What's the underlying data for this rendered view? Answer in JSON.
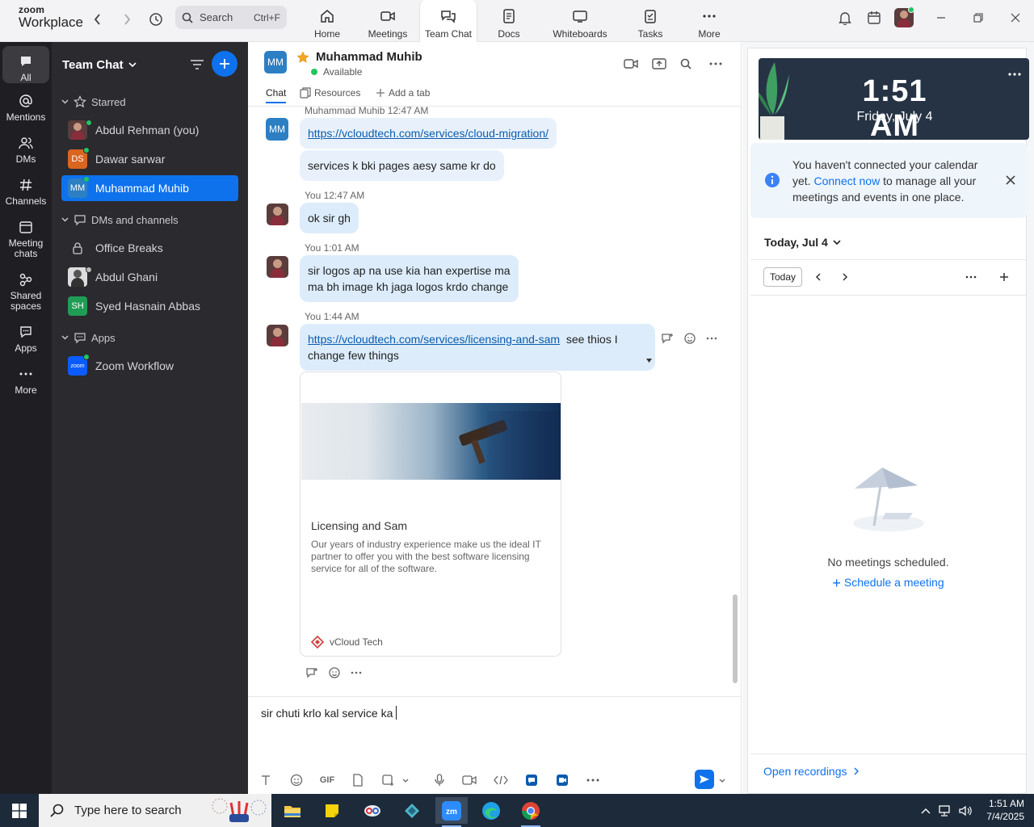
{
  "app": {
    "brand_top": "zoom",
    "brand_bottom": "Workplace"
  },
  "search": {
    "placeholder": "Search",
    "shortcut": "Ctrl+F"
  },
  "tabs": [
    {
      "label": "Home",
      "icon": "home-icon"
    },
    {
      "label": "Meetings",
      "icon": "video-camera-icon"
    },
    {
      "label": "Team Chat",
      "icon": "chat-bubbles-icon",
      "active": true
    },
    {
      "label": "Docs",
      "icon": "document-icon"
    },
    {
      "label": "Whiteboards",
      "icon": "whiteboard-icon"
    },
    {
      "label": "Tasks",
      "icon": "tasks-icon"
    },
    {
      "label": "More",
      "icon": "more-dots-icon"
    }
  ],
  "rail": [
    {
      "label": "All",
      "icon": "chat-icon",
      "active": true
    },
    {
      "label": "Mentions",
      "icon": "at-sign-icon"
    },
    {
      "label": "DMs",
      "icon": "people-icon"
    },
    {
      "label": "Channels",
      "icon": "hash-icon"
    },
    {
      "label": "Meeting chats",
      "icon": "calendar-chat-icon"
    },
    {
      "label": "Shared spaces",
      "icon": "shared-spaces-icon"
    },
    {
      "label": "Apps",
      "icon": "apps-icon"
    },
    {
      "label": "More",
      "icon": "more-dots-icon"
    }
  ],
  "chanpanel": {
    "title": "Team Chat",
    "sections": {
      "starred": "Starred",
      "dms": "DMs and channels",
      "apps": "Apps"
    },
    "starred": [
      {
        "name": "Abdul Rehman (you)",
        "initials": ""
      },
      {
        "name": "Dawar sarwar",
        "initials": "DS"
      },
      {
        "name": "Muhammad Muhib",
        "initials": "MM",
        "active": true
      }
    ],
    "dms": [
      {
        "name": "Office Breaks"
      },
      {
        "name": "Abdul Ghani"
      },
      {
        "name": "Syed Hasnain Abbas",
        "initials": "SH"
      }
    ],
    "apps": [
      {
        "name": "Zoom Workflow",
        "initials": "zoom"
      }
    ]
  },
  "chat": {
    "contact_initials": "MM",
    "contact_name": "Muhammad Muhib",
    "status": "Available",
    "tabs": {
      "chat": "Chat",
      "resources": "Resources",
      "add": "Add a tab"
    },
    "messages": {
      "m1_meta": "Muhammad Muhib 12:47 AM",
      "m1_link": "https://vcloudtech.com/services/cloud-migration/",
      "m1_text2": "services k bki pages aesy same kr do",
      "m2_meta": "You 12:47 AM",
      "m2_text": "ok sir gh",
      "m3_meta": "You 1:01 AM",
      "m3_line1": "sir logos ap na use kia han expertise ma",
      "m3_line2": "ma bh image kh jaga logos krdo change",
      "m4_meta": "You 1:44 AM",
      "m4_link": "https://vcloudtech.com/services/licensing-and-sam",
      "m4_text_a": "see thios I",
      "m4_text_b": "change few things"
    },
    "card": {
      "title": "Licensing and Sam",
      "description": "Our years of industry experience make us the ideal IT partner to offer you with the best software licensing service for all of the software.",
      "site": "vCloud Tech"
    },
    "compose_text": "sir chuti krlo kal service ka",
    "gif_label": "GIF"
  },
  "calendar": {
    "time": "1:51 AM",
    "date": "Friday, July 4",
    "notice_pre": "You haven't connected your calendar yet.",
    "notice_link": "Connect now",
    "notice_post": "to manage all your meetings and events in one place.",
    "today_header": "Today, Jul 4",
    "today_button": "Today",
    "empty": "No meetings scheduled.",
    "schedule": "Schedule a meeting",
    "open_recordings": "Open recordings"
  },
  "taskbar": {
    "search_placeholder": "Type here to search",
    "time": "1:51 AM",
    "date": "7/4/2025"
  },
  "colors": {
    "accent": "#0e72ed",
    "rail_bg": "#1f1f23",
    "panel_bg": "#2a2a2f",
    "online": "#22c55e"
  }
}
